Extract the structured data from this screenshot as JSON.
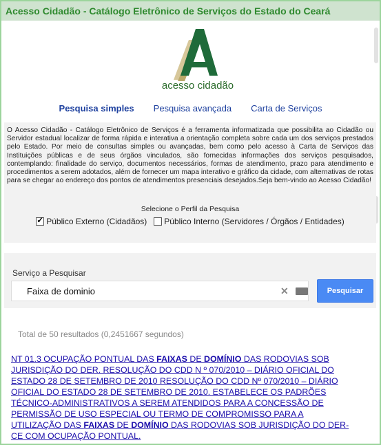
{
  "window": {
    "title": "Acesso Cidadão - Catálogo Eletrônico de Serviços do Estado do Ceará"
  },
  "logo": {
    "icon": "logo-a-icon",
    "text": "acesso cidadão"
  },
  "tabs": [
    {
      "label": "Pesquisa simples"
    },
    {
      "label": "Pesquisa avançada"
    },
    {
      "label": "Carta de Serviços"
    }
  ],
  "description": "O Acesso Cidadão - Catálogo Eletrônico de Serviços é a ferramenta informatizada que possibilita ao Cidadão ou Servidor estadual localizar de forma rápida e interativa a orientação completa sobre cada um dos serviços prestados pelo Estado. Por meio de consultas simples ou avançadas, bem como pelo acesso à Carta de Serviços das Instituições públicas e de seus órgãos vinculados, são fornecidas informações dos serviços pesquisados, contemplando: finalidade do serviço, documentos necessários, formas de atendimento, prazo para atendimento e procedimentos a serem adotados, além de fornecer um mapa interativo e gráfico da cidade, com alternativas de rotas para se chegar ao endereço dos pontos de atendimentos presenciais desejados.Seja bem-vindo ao Acesso Cidadão!",
  "perfil": {
    "title": "Selecione o Perfil da Pesquisa",
    "options": [
      {
        "label": "Público Externo (Cidadãos)",
        "checked": true
      },
      {
        "label": "Público Interno (Servidores / Órgãos / Entidades)",
        "checked": false
      }
    ]
  },
  "search": {
    "label": "Serviço a Pesquisar",
    "value": "Faixa de dominio",
    "button_label": "Pesquisar"
  },
  "results": {
    "count_text": "Total de 50 resultados (0,2451667 segundos)",
    "first_link": {
      "p1": "NT 01.3 OCUPAÇÃO PONTUAL DAS ",
      "b1": "FAIXAS",
      "p2": " DE ",
      "b2": "DOMÍNIO",
      "p3": " DAS RODOVIAS SOB JURISDIÇÃO DO DER. RESOLUÇÃO DO CDD N º 070/2010 – DIÁRIO OFICIAL DO ESTADO 28 DE SETEMBRO DE 2010 RESOLUÇÃO DO CDD Nº 070/2010 – DIÁRIO OFICIAL DO ESTADO 28 DE SETEMBRO DE 2010. ESTABELECE OS PADRÕES TÉCNICO-ADMINISTRATIVOS A SEREM ATENDIDOS PARA A CONCESSÃO DE PERMISSÃO DE USO ESPECIAL OU TERMO DE COMPROMISSO PARA A UTILIZAÇÃO DAS ",
      "b3": "FAIXAS",
      "p4": " DE ",
      "b4": "DOMÍNIO",
      "p5": " DAS RODOVIAS SOB JURISDIÇÃO DO DER-CE COM OCUPAÇÃO PONTUAL."
    }
  }
}
